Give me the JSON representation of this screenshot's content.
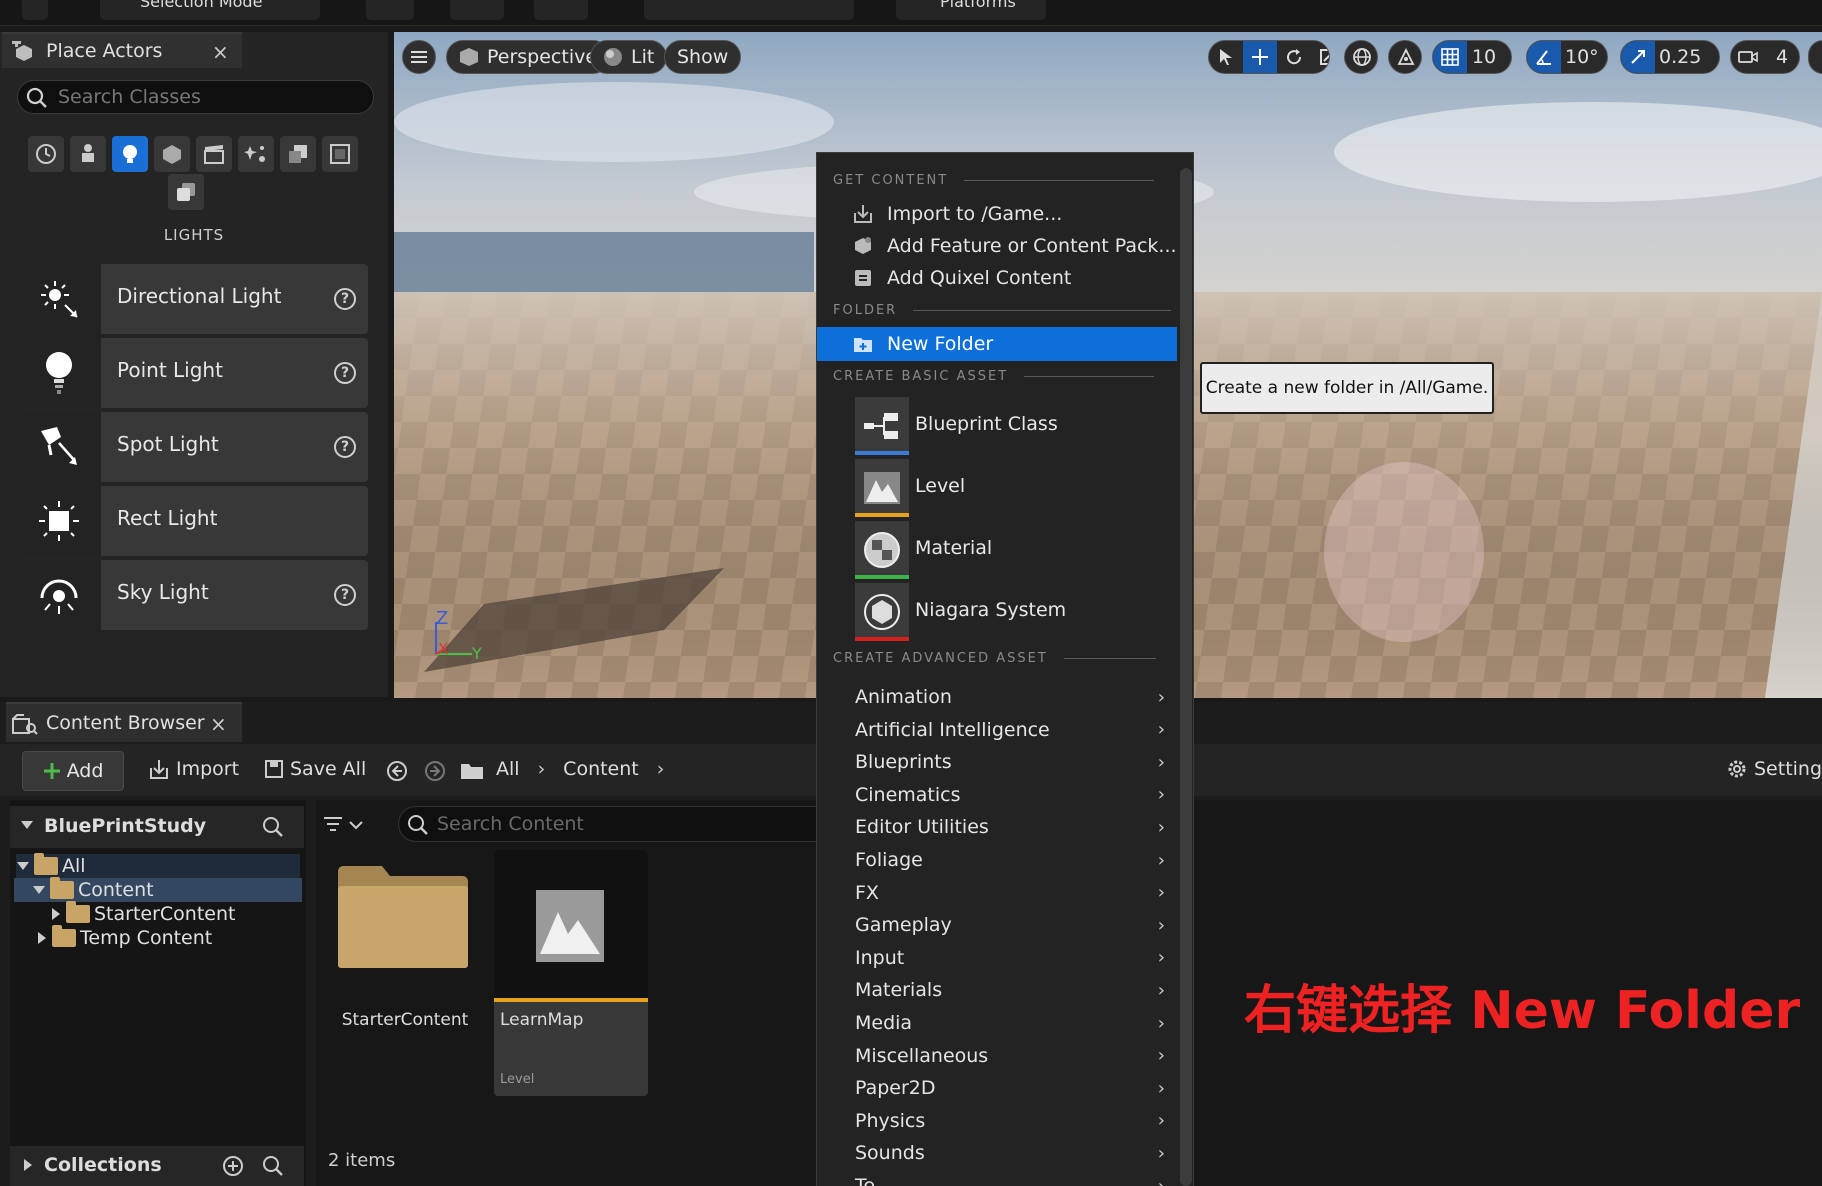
{
  "toolbar": {
    "mode_label": "Selection Mode",
    "platforms_label": "Platforms"
  },
  "place_actors": {
    "tab_label": "Place Actors",
    "search_placeholder": "Search Classes",
    "category_title": "LIGHTS",
    "categories": [
      "recent-icon",
      "basic-icon",
      "lights-icon",
      "shapes-icon",
      "cinematic-icon",
      "visual-effects-icon",
      "volumes-icon",
      "all-classes-icon",
      "geometry-icon"
    ],
    "items": [
      {
        "label": "Directional Light",
        "icon": "directional-light-icon",
        "help": "?"
      },
      {
        "label": "Point Light",
        "icon": "point-light-icon",
        "help": "?"
      },
      {
        "label": "Spot Light",
        "icon": "spot-light-icon",
        "help": "?"
      },
      {
        "label": "Rect Light",
        "icon": "rect-light-icon",
        "help": ""
      },
      {
        "label": "Sky Light",
        "icon": "sky-light-icon",
        "help": "?"
      }
    ]
  },
  "viewport": {
    "perspective_label": "Perspective",
    "lit_label": "Lit",
    "show_label": "Show",
    "grid_snap": "10",
    "rotation_snap": "10°",
    "scale_snap": "0.25",
    "camera_speed": "4",
    "axis_z": "Z",
    "axis_x": "X",
    "axis_y": "Y"
  },
  "content_browser": {
    "tab_label": "Content Browser",
    "add_label": "Add",
    "import_label": "Import",
    "save_all_label": "Save All",
    "breadcrumb": [
      "All",
      "Content"
    ],
    "settings_label": "Settings",
    "project_name": "BluePrintStudy",
    "tree": [
      {
        "label": "All",
        "level": 0,
        "expanded": true
      },
      {
        "label": "Content",
        "level": 1,
        "expanded": true,
        "selected": true
      },
      {
        "label": "StarterContent",
        "level": 2,
        "expanded": false
      },
      {
        "label": "Temp Content",
        "level": 1,
        "expanded": false
      }
    ],
    "collections_label": "Collections",
    "search_placeholder": "Search Content",
    "assets": [
      {
        "name": "StarterContent",
        "type": "folder"
      },
      {
        "name": "LearnMap",
        "type": "Level"
      }
    ],
    "item_count": "2 items"
  },
  "context_menu": {
    "sections": {
      "get_content": "GET CONTENT",
      "folder": "FOLDER",
      "create_basic": "CREATE BASIC ASSET",
      "create_advanced": "CREATE ADVANCED ASSET"
    },
    "get_content_items": [
      "Import to /Game...",
      "Add Feature or Content Pack...",
      "Add Quixel Content"
    ],
    "new_folder": "New Folder",
    "basic_assets": [
      {
        "label": "Blueprint Class",
        "color": "#3a7bd5"
      },
      {
        "label": "Level",
        "color": "#e8a020"
      },
      {
        "label": "Material",
        "color": "#3bb34a"
      },
      {
        "label": "Niagara System",
        "color": "#d62020"
      }
    ],
    "advanced_assets": [
      "Animation",
      "Artificial Intelligence",
      "Blueprints",
      "Cinematics",
      "Editor Utilities",
      "Foliage",
      "FX",
      "Gameplay",
      "Input",
      "Materials",
      "Media",
      "Miscellaneous",
      "Paper2D",
      "Physics",
      "Sounds",
      "Te"
    ]
  },
  "tooltip": "Create a new folder in /All/Game.",
  "annotation": "右键选择  New Folder"
}
